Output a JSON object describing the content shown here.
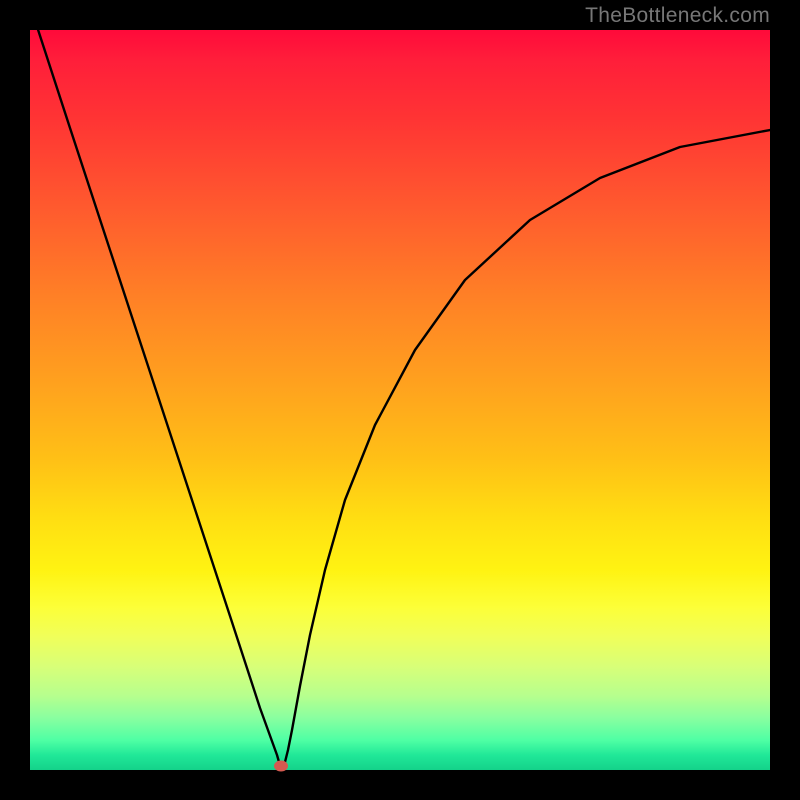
{
  "watermark": "TheBottleneck.com",
  "chart_data": {
    "type": "line",
    "title": "",
    "xlabel": "",
    "ylabel": "",
    "xlim": [
      0,
      740
    ],
    "ylim_domain_note": "y=0 is bottom of gradient (green), y=740 is top (red); plotted in SVG with y inverted",
    "series": [
      {
        "name": "left-branch",
        "description": "near-linear descent from top-left to the minimum",
        "points_xy_bottom_origin": [
          [
            0,
            765
          ],
          [
            40,
            642
          ],
          [
            80,
            520
          ],
          [
            120,
            398
          ],
          [
            160,
            276
          ],
          [
            200,
            154
          ],
          [
            230,
            62
          ],
          [
            247,
            15
          ]
        ]
      },
      {
        "name": "right-branch",
        "description": "steep rise out of the minimum, decelerating toward the right edge",
        "points_xy_bottom_origin": [
          [
            255,
            5
          ],
          [
            262,
            40
          ],
          [
            275,
            110
          ],
          [
            295,
            200
          ],
          [
            325,
            300
          ],
          [
            370,
            400
          ],
          [
            430,
            485
          ],
          [
            510,
            555
          ],
          [
            600,
            600
          ],
          [
            680,
            625
          ],
          [
            740,
            640
          ]
        ]
      }
    ],
    "minimum_marker": {
      "x": 251,
      "y_bottom_origin": 4,
      "color": "#d45a50"
    },
    "gradient_stops": [
      {
        "pct": 0,
        "color": "#ff0a3a"
      },
      {
        "pct": 12,
        "color": "#ff3434"
      },
      {
        "pct": 36,
        "color": "#ff8026"
      },
      {
        "pct": 58,
        "color": "#ffc016"
      },
      {
        "pct": 78,
        "color": "#fcff38"
      },
      {
        "pct": 93,
        "color": "#88ffa0"
      },
      {
        "pct": 100,
        "color": "#14d28a"
      }
    ]
  }
}
